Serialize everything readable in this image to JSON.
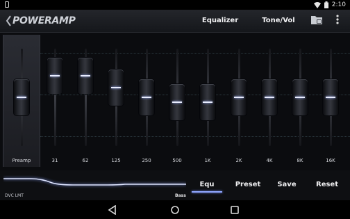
{
  "status_bar": {
    "time": "2:10",
    "icons": [
      "notification-icon",
      "wifi-icon",
      "battery-icon"
    ]
  },
  "header": {
    "brand": "POWERAMP",
    "tabs": [
      {
        "label": "Equalizer",
        "active": true
      },
      {
        "label": "Tone/Vol",
        "active": false
      }
    ],
    "icons": [
      "back-chevron-icon",
      "folder-presets-icon",
      "overflow-menu-icon"
    ]
  },
  "equalizer": {
    "preamp": {
      "label": "Preamp",
      "level": 0.0
    },
    "bands": [
      {
        "label": "31",
        "level": 0.45
      },
      {
        "label": "62",
        "level": 0.45
      },
      {
        "label": "125",
        "level": 0.2
      },
      {
        "label": "250",
        "level": 0.0
      },
      {
        "label": "500",
        "level": -0.1
      },
      {
        "label": "1K",
        "level": -0.1
      },
      {
        "label": "2K",
        "level": 0.0
      },
      {
        "label": "4K",
        "level": 0.0
      },
      {
        "label": "8K",
        "level": 0.0
      },
      {
        "label": "16K",
        "level": 0.0
      }
    ]
  },
  "bottom": {
    "dvc_label": "DVC LMT",
    "bass_label": "Bass",
    "actions": [
      {
        "label": "Equ",
        "active": true
      },
      {
        "label": "Preset",
        "active": false
      },
      {
        "label": "Save",
        "active": false
      },
      {
        "label": "Reset",
        "active": false
      }
    ]
  },
  "nav_bar": {
    "icons": [
      "nav-back-icon",
      "nav-home-icon",
      "nav-recents-icon"
    ]
  },
  "colors": {
    "accent": "#8fa6ff",
    "background": "#0e0f12"
  }
}
